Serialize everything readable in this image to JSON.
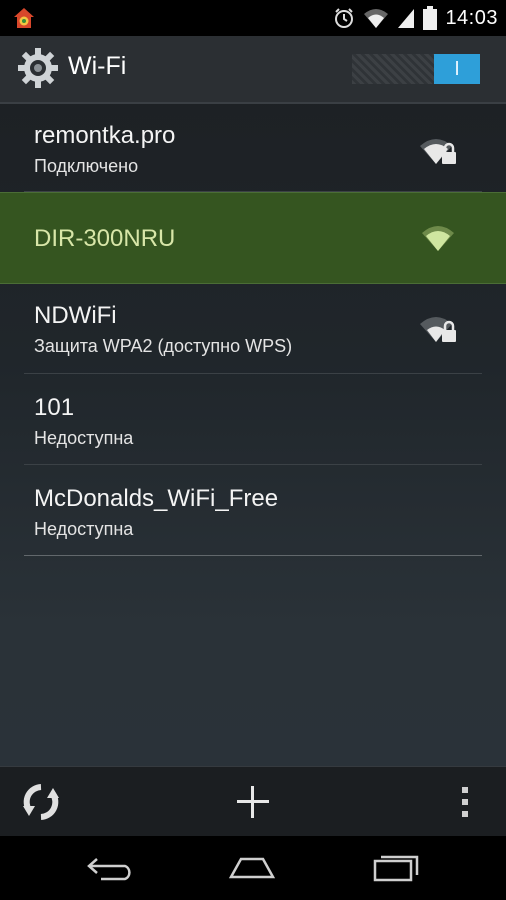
{
  "status_bar": {
    "time": "14:03",
    "icons": [
      "notification-app-icon",
      "alarm-icon",
      "wifi-signal-icon",
      "cell-signal-icon",
      "battery-icon"
    ]
  },
  "action_bar": {
    "title": "Wi-Fi",
    "icon": "settings-gear-icon",
    "toggle_label": "I",
    "toggle_state": "on",
    "accent_color": "#2e9fd9"
  },
  "networks": [
    {
      "ssid": "remontka.pro",
      "status": "Подключено",
      "icon": "wifi-locked-icon",
      "selected": false
    },
    {
      "ssid": "DIR-300NRU",
      "status": "",
      "icon": "wifi-icon",
      "selected": true
    },
    {
      "ssid": "NDWiFi",
      "status": "Защита WPA2 (доступно WPS)",
      "icon": "wifi-locked-icon",
      "selected": false
    },
    {
      "ssid": "101",
      "status": "Недоступна",
      "icon": "",
      "selected": false
    },
    {
      "ssid": "McDonalds_WiFi_Free",
      "status": "Недоступна",
      "icon": "",
      "selected": false
    }
  ],
  "bottom_bar": {
    "buttons": [
      "scan-icon",
      "add-network-icon",
      "overflow-menu-icon"
    ]
  },
  "nav_bar": {
    "buttons": [
      "back-icon",
      "home-icon",
      "recent-apps-icon"
    ]
  },
  "colors": {
    "selected_row": "#355520",
    "selected_text": "#d8e6a8"
  }
}
